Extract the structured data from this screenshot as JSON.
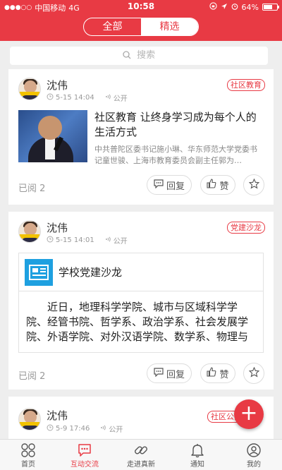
{
  "status_bar": {
    "carrier": "中国移动",
    "network": "4G",
    "time": "10:58",
    "battery": "64%"
  },
  "header": {
    "tabs": [
      {
        "label": "全部",
        "active": false
      },
      {
        "label": "精选",
        "active": true
      }
    ]
  },
  "search": {
    "placeholder": "搜索"
  },
  "posts": [
    {
      "author": "沈伟",
      "time": "5-15 14:04",
      "visibility": "公开",
      "tag": "社区教育",
      "article_title": "社区教育  让终身学习成为每个人的生活方式",
      "article_summary": "中共普陀区委书记施小琳、华东师范大学党委书记童世骏、上海市教育委员会副主任郭为…",
      "read_count": "已阅 2",
      "reply_label": "回复",
      "like_label": "赞"
    },
    {
      "author": "沈伟",
      "time": "5-15 14:01",
      "visibility": "公开",
      "tag": "党建沙龙",
      "embed_title": "学校党建沙龙",
      "embed_text": "近日，地理科学学院、城市与区域科学学院、经管书院、哲学系、政治学系、社会发展学院、外语学院、对外汉语学院、数学系、物理与",
      "read_count": "已阅 2",
      "reply_label": "回复",
      "like_label": "赞"
    },
    {
      "author": "沈伟",
      "time": "5-9 17:46",
      "visibility": "公开",
      "tag": "社区公共"
    }
  ],
  "tabbar": [
    {
      "label": "首页",
      "icon": "grid-icon",
      "active": false
    },
    {
      "label": "互动交流",
      "icon": "chat-icon",
      "active": true
    },
    {
      "label": "走进真新",
      "icon": "link-icon",
      "active": false
    },
    {
      "label": "通知",
      "icon": "bell-icon",
      "active": false
    },
    {
      "label": "我的",
      "icon": "user-icon",
      "active": false
    }
  ],
  "colors": {
    "accent": "#e83a44",
    "info_blue": "#1ea0e0"
  }
}
